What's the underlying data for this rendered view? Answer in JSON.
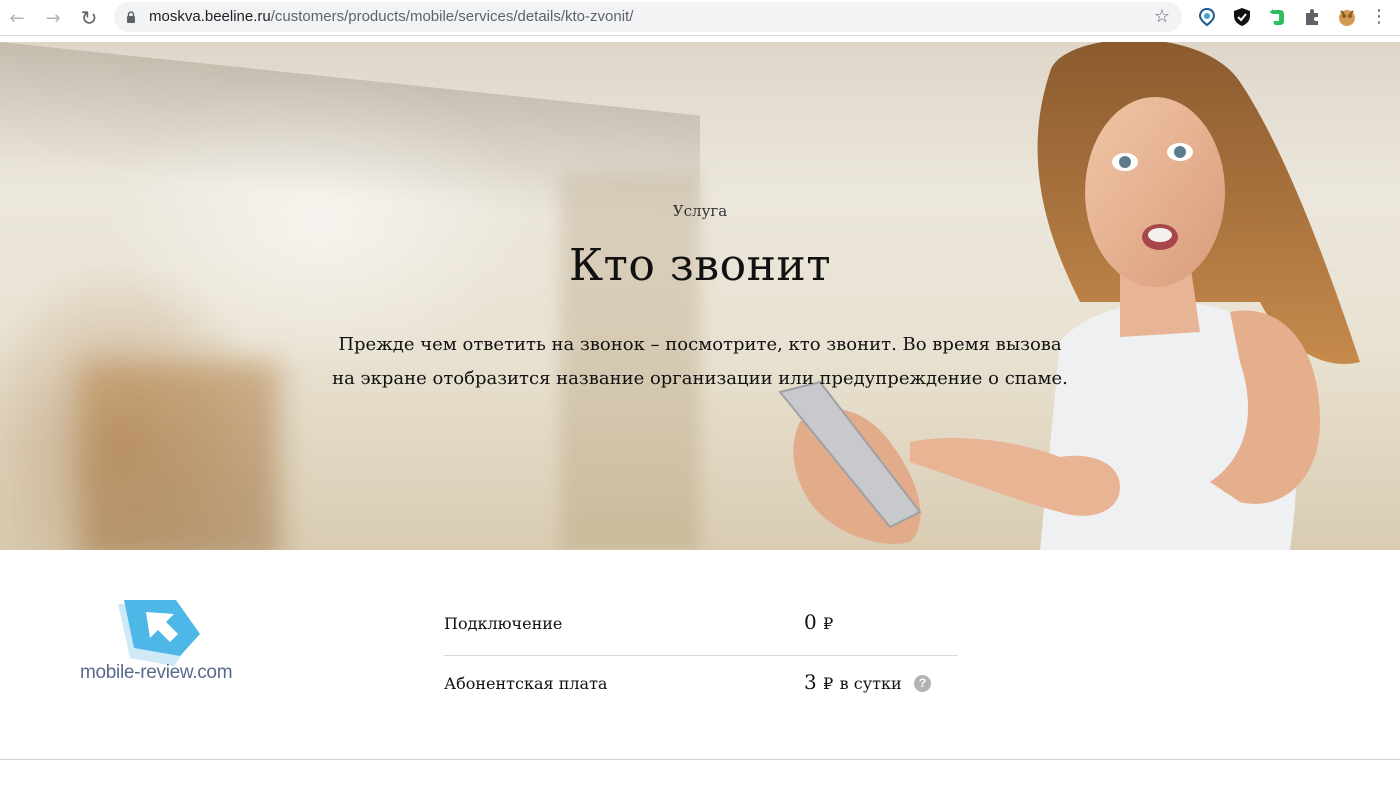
{
  "browser": {
    "url_host": "moskva.beeline.ru",
    "url_path": "/customers/products/mobile/services/details/kto-zvonit/",
    "icons": {
      "back": "arrow-left-icon",
      "forward": "arrow-right-icon",
      "reload": "reload-icon",
      "bookmark": "star-icon",
      "menu": "kebab-menu-icon"
    },
    "extensions": [
      "location-pin-extension-icon",
      "shield-extension-icon",
      "evernote-extension-icon",
      "puzzle-extension-icon",
      "avatar-extension-icon"
    ]
  },
  "hero": {
    "label": "Услуга",
    "title": "Кто звонит",
    "description_line1": "Прежде чем ответить на звонок – посмотрите, кто звонит. Во время вызова",
    "description_line2": "на экране отобразится название организации или предупреждение о спаме."
  },
  "logo": {
    "text": "mobile-review.com"
  },
  "pricing": {
    "rows": [
      {
        "label": "Подключение",
        "amount": "0",
        "currency": "₽",
        "period": ""
      },
      {
        "label": "Абонентская плата",
        "amount": "3",
        "currency": "₽",
        "period": "в сутки",
        "help": "?"
      }
    ]
  },
  "colors": {
    "logo_blue": "#4db8e8",
    "logo_text": "#5a6a8c",
    "help_badge": "#b3b3b3",
    "evernote_green": "#2dbe60"
  }
}
